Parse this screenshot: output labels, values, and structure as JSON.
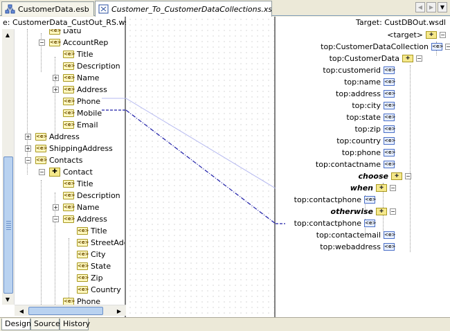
{
  "tabs": [
    {
      "label": "CustomerData.esb",
      "icon": "esb-diagram-icon"
    },
    {
      "label": "Customer_To_CustomerDataCollections.xsl",
      "icon": "xsl-map-icon"
    }
  ],
  "left": {
    "header": "e: CustomerData_CustOut_RS.wsdl",
    "items": [
      {
        "label": "Datu",
        "exp": ""
      },
      {
        "label": "AccountRep",
        "exp": "−"
      },
      {
        "label": "Title",
        "exp": ""
      },
      {
        "label": "Description",
        "exp": ""
      },
      {
        "label": "Name",
        "exp": "+"
      },
      {
        "label": "Address",
        "exp": "+"
      },
      {
        "label": "Phone",
        "exp": ""
      },
      {
        "label": "Mobile",
        "exp": ""
      },
      {
        "label": "Email",
        "exp": ""
      },
      {
        "label": "Address",
        "exp": "+"
      },
      {
        "label": "ShippingAddress",
        "exp": "+"
      },
      {
        "label": "Contacts",
        "exp": "−"
      },
      {
        "label": "Contact",
        "exp": "−"
      },
      {
        "label": "Title",
        "exp": ""
      },
      {
        "label": "Description",
        "exp": ""
      },
      {
        "label": "Name",
        "exp": "+"
      },
      {
        "label": "Address",
        "exp": "−"
      },
      {
        "label": "Title",
        "exp": ""
      },
      {
        "label": "StreetAdd",
        "exp": ""
      },
      {
        "label": "City",
        "exp": ""
      },
      {
        "label": "State",
        "exp": ""
      },
      {
        "label": "Zip",
        "exp": ""
      },
      {
        "label": "Country",
        "exp": ""
      },
      {
        "label": "Phone",
        "exp": ""
      }
    ]
  },
  "right": {
    "header": "Target: CustDBOut.wsdl",
    "items": [
      {
        "label": "<target>"
      },
      {
        "label": "top:CustomerDataCollection"
      },
      {
        "label": "top:CustomerData"
      },
      {
        "label": "top:customerid"
      },
      {
        "label": "top:name"
      },
      {
        "label": "top:address"
      },
      {
        "label": "top:city"
      },
      {
        "label": "top:state"
      },
      {
        "label": "top:zip"
      },
      {
        "label": "top:country"
      },
      {
        "label": "top:phone"
      },
      {
        "label": "top:contactname"
      },
      {
        "label": "choose"
      },
      {
        "label": "when"
      },
      {
        "label": "top:contactphone"
      },
      {
        "label": "otherwise"
      },
      {
        "label": "top:contactphone"
      },
      {
        "label": "top:contactemail"
      },
      {
        "label": "top:webaddress"
      }
    ]
  },
  "icons": {
    "element": "<e>"
  },
  "bottom_tabs": [
    "Design",
    "Source",
    "History"
  ]
}
